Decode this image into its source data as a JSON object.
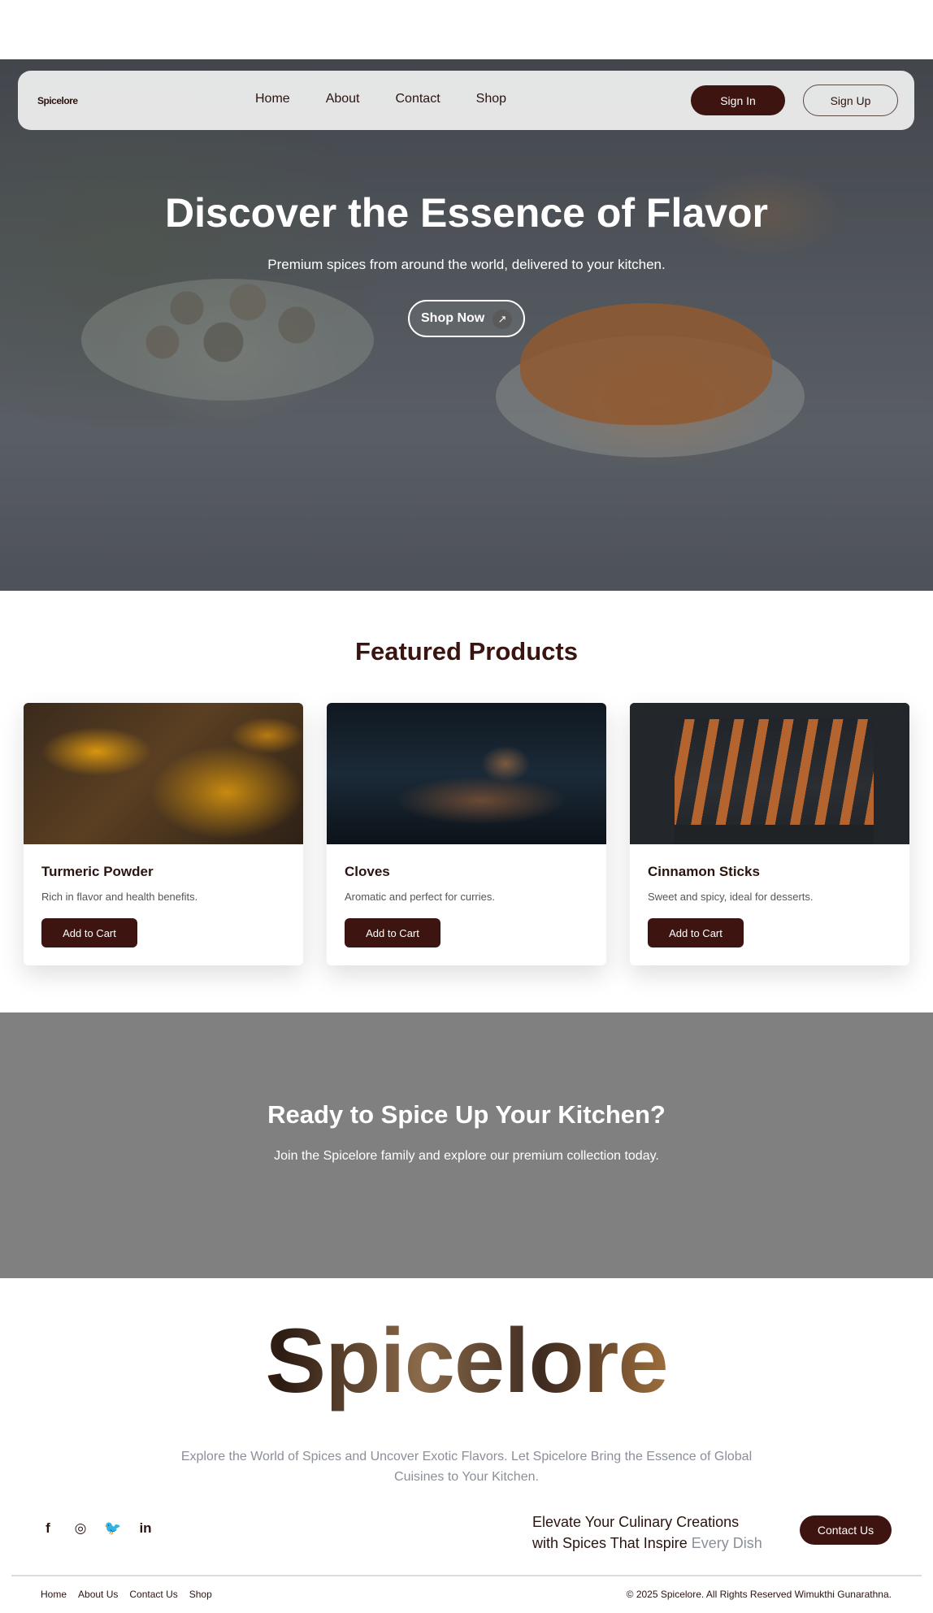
{
  "nav": {
    "logo": "Spicelore",
    "links": [
      "Home",
      "About",
      "Contact",
      "Shop"
    ],
    "signin_label": "Sign In",
    "signup_label": "Sign Up"
  },
  "hero": {
    "title": "Discover the Essence of Flavor",
    "subtitle": "Premium spices from around the world, delivered to your kitchen.",
    "cta_label": "Shop Now",
    "cta_icon": "↗"
  },
  "featured": {
    "title": "Featured Products",
    "products": [
      {
        "name": "Turmeric Powder",
        "description": "Rich in flavor and health benefits.",
        "button": "Add to Cart"
      },
      {
        "name": "Cloves",
        "description": "Aromatic and perfect for curries.",
        "button": "Add to Cart"
      },
      {
        "name": "Cinnamon Sticks",
        "description": "Sweet and spicy, ideal for desserts.",
        "button": "Add to Cart"
      }
    ]
  },
  "cta": {
    "title": "Ready to Spice Up Your Kitchen?",
    "subtitle": "Join the Spicelore family and explore our premium collection today."
  },
  "footer": {
    "brand": "Spicelore",
    "tagline": "Explore the World of Spices and Uncover Exotic Flavors. Let Spicelore Bring the Essence of Global Cuisines to Your Kitchen.",
    "socials": [
      {
        "icon": "facebook-icon",
        "glyph": "f"
      },
      {
        "icon": "instagram-icon",
        "glyph": "◎"
      },
      {
        "icon": "twitter-icon",
        "glyph": "🐦"
      },
      {
        "icon": "linkedin-icon",
        "glyph": "in"
      }
    ],
    "elevate_line1": "Elevate Your Culinary Creations",
    "elevate_line2": "with Spices That Inspire ",
    "elevate_muted": "Every Dish",
    "contact_label": "Contact Us",
    "links": [
      "Home",
      "About Us",
      "Contact Us",
      "Shop"
    ],
    "copyright": "© 2025 Spicelore. All Rights Reserved Wimukthi Gunarathna."
  },
  "colors": {
    "brand_dark": "#3d1410",
    "cta_bg": "#808080",
    "muted_text": "#8a8f99"
  }
}
